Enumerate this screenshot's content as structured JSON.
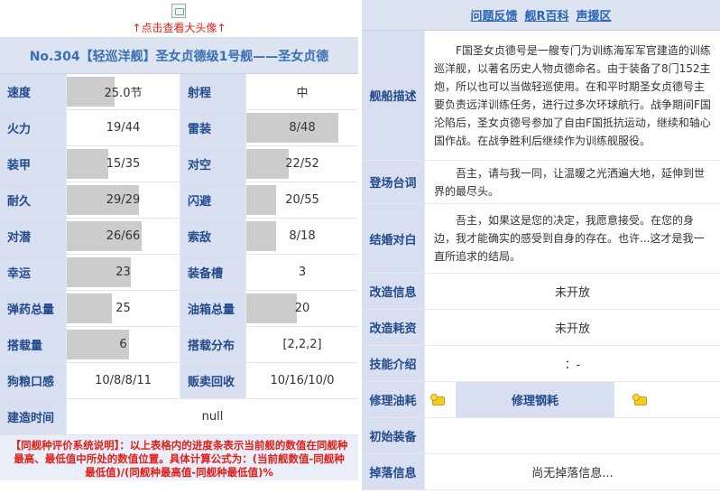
{
  "avatar": {
    "link_text": "↑点击查看大头像↑"
  },
  "ship_title": "No.304【轻巡洋舰】圣女贞德级1号舰——圣女贞德",
  "stats": [
    {
      "l1": "速度",
      "v1": "25.0节",
      "p1": 0.42,
      "l2": "射程",
      "v2": "中",
      "p2": 0
    },
    {
      "l1": "火力",
      "v1": "19/44",
      "p1": 0.0,
      "l2": "雷装",
      "v2": "8/48",
      "p2": 0.82
    },
    {
      "l1": "装甲",
      "v1": "15/35",
      "p1": 0.37,
      "l2": "对空",
      "v2": "22/52",
      "p2": 0.38
    },
    {
      "l1": "耐久",
      "v1": "29/29",
      "p1": 0.64,
      "l2": "闪避",
      "v2": "20/55",
      "p2": 0.27
    },
    {
      "l1": "对潜",
      "v1": "26/66",
      "p1": 0.66,
      "l2": "索敌",
      "v2": "8/18",
      "p2": 0.27
    },
    {
      "l1": "幸运",
      "v1": "23",
      "p1": 0.57,
      "l2": "装备槽",
      "v2": "3",
      "p2": 0
    },
    {
      "l1": "弹药总量",
      "v1": "25",
      "p1": 0.4,
      "l2": "油箱总量",
      "v2": "20",
      "p2": 0.45
    },
    {
      "l1": "搭载量",
      "v1": "6",
      "p1": 0.55,
      "l2": "搭载分布",
      "v2": "[2,2,2]",
      "p2": 0
    },
    {
      "l1": "狗粮口感",
      "v1": "10/8/8/11",
      "p1": 0,
      "l2": "贩卖回收",
      "v2": "10/16/10/0",
      "p2": 0
    }
  ],
  "build_time": {
    "label": "建造时间",
    "value": "null"
  },
  "note": "【同舰种评价系统说明】：以上表格内的进度条表示当前舰的数值在同舰种最高、最低值中所处的数值位置。具体计算公式为：(当前舰数值-同舰种最低值)/(同舰种最高值-同舰种最低值)%",
  "links": [
    "问题反馈",
    "舰R百科",
    "声援区"
  ],
  "info": {
    "desc_label": "舰船描述",
    "desc_text": "F国圣女贞德号是一艘专门为训练海军军官建造的训练巡洋舰，以著名历史人物贞德命名。由于装备了8门152主炮，所以也可以当做轻巡使用。在和平时期圣女贞德号主要负责远洋训练任务，进行过多次环球航行。战争期间F国沦陷后，圣女贞德号参加了自由F国抵抗运动，继续和轴心国作战。在战争胜利后继续作为训练舰服役。",
    "login_label": "登场台词",
    "login_text": "吾主，请与我一同，让温暖之光洒遍大地，延伸到世界的最尽头。",
    "marry_label": "结婚对白",
    "marry_text": "吾主，如果这是您的决定，我愿意接受。在您的身边，我才能确实的感受到自身的存在。也许...这才是我一直所追求的结局。",
    "remodel_label": "改造信息",
    "remodel_value": "未开放",
    "remodel_cost_label": "改造耗资",
    "remodel_cost_value": "未开放",
    "skill_label": "技能介绍",
    "skill_value": "：-",
    "repair_oil_label": "修理油耗",
    "repair_steel_label": "修理钢耗",
    "init_equip_label": "初始装备",
    "drop_label": "掉落信息",
    "drop_value": "尚无掉落信息..."
  }
}
